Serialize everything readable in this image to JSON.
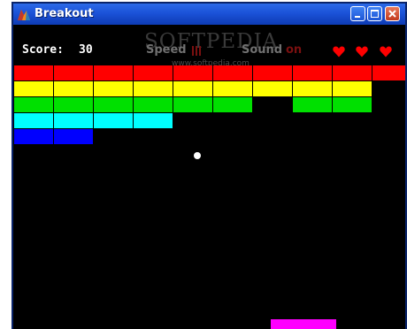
{
  "window": {
    "title": "Breakout",
    "controls": [
      "minimize-icon",
      "maximize-icon",
      "close-icon"
    ]
  },
  "hud": {
    "score_label": "Score:",
    "score_value": "30",
    "speed_label": "Speed",
    "sound_label": "Sound",
    "sound_value": "on",
    "lives": 3
  },
  "watermark": {
    "text": "SOFTPEDIA",
    "url": "www.softpedia.com"
  },
  "colors": {
    "red": "#ff0000",
    "yellow": "#ffff00",
    "green": "#00e000",
    "cyan": "#00ffff",
    "blue": "#0000ff",
    "paddle": "#ff00ff",
    "heart": "#ff0000"
  },
  "bricks": {
    "rows": [
      {
        "color": "red",
        "present": [
          1,
          1,
          1,
          1,
          1,
          1,
          1,
          1,
          1,
          1
        ]
      },
      {
        "color": "yellow",
        "present": [
          1,
          1,
          1,
          1,
          1,
          1,
          1,
          1,
          1,
          0
        ]
      },
      {
        "color": "green",
        "present": [
          1,
          1,
          1,
          1,
          1,
          1,
          0,
          1,
          1,
          0
        ]
      },
      {
        "color": "cyan",
        "present": [
          1,
          1,
          1,
          1,
          0,
          0,
          0,
          0,
          0,
          0
        ]
      },
      {
        "color": "blue",
        "present": [
          1,
          1,
          0,
          0,
          0,
          0,
          0,
          0,
          0,
          0
        ]
      }
    ]
  }
}
